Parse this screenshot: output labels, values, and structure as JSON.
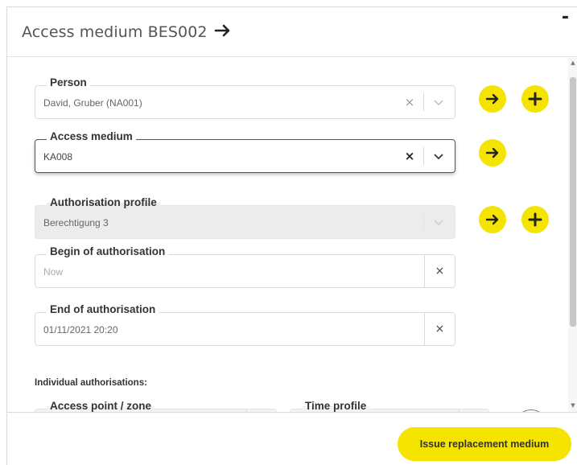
{
  "dialog": {
    "title": "Access medium BES002",
    "minimize_label": "-"
  },
  "fields": {
    "person": {
      "label": "Person",
      "value": "David, Gruber (NA001)"
    },
    "access_medium": {
      "label": "Access medium",
      "value": "KA008"
    },
    "authorisation_profile": {
      "label": "Authorisation profile",
      "value": "Berechtigung 3"
    },
    "begin_of_authorisation": {
      "label": "Begin of authorisation",
      "placeholder": "Now"
    },
    "end_of_authorisation": {
      "label": "End of authorisation",
      "value": "01/11/2021 20:20"
    }
  },
  "individual": {
    "title": "Individual authorisations:",
    "col_access_point": "Access point / zone",
    "col_time_profile": "Time profile"
  },
  "footer": {
    "primary_button": "Issue replacement medium"
  },
  "icons": {
    "clear": "×",
    "accent_color": "#f5e400"
  }
}
